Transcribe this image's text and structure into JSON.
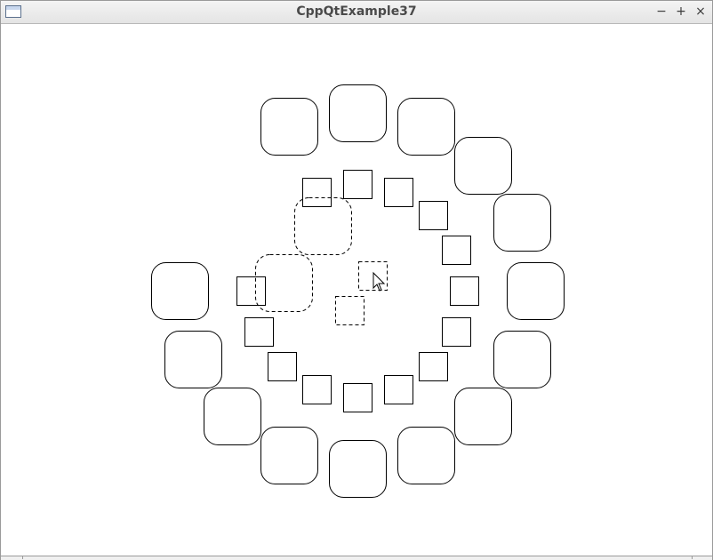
{
  "window": {
    "title": "CppQtExample37",
    "minimize_glyph": "−",
    "maximize_glyph": "+",
    "close_glyph": "×",
    "app_icon": "window-app-icon"
  },
  "scene": {
    "description_items": "rounded rectangles and squares arranged on concentric rings",
    "stroke_color": "#000000",
    "background_color": "#ffffff",
    "cursor_icon": "arrow-cursor-icon"
  }
}
